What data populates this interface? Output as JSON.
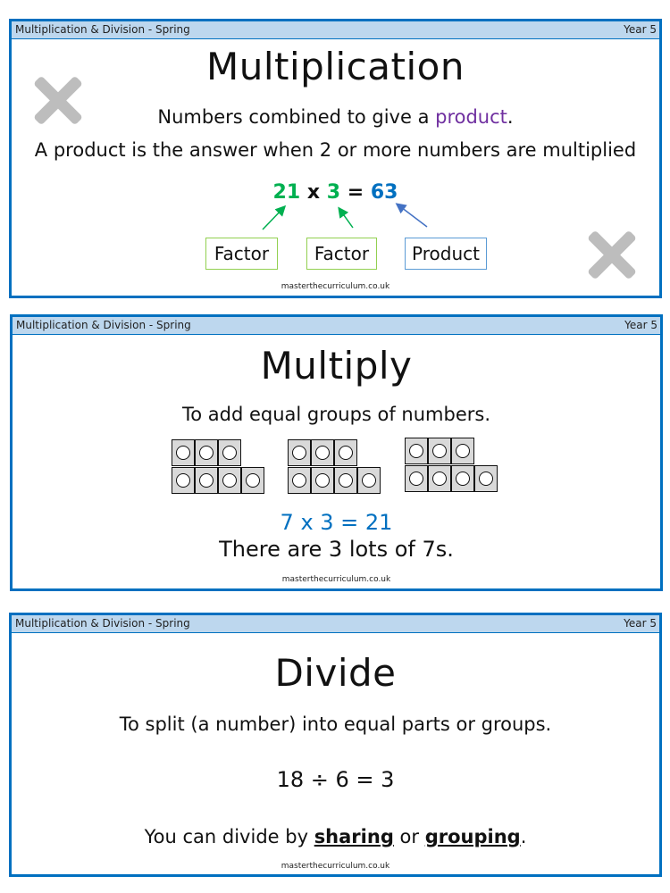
{
  "header": {
    "topic": "Multiplication & Division - Spring",
    "year": "Year 5"
  },
  "footer": "masterthecurriculum.co.uk",
  "cards": [
    {
      "title": "Multiplication",
      "line1_prefix": "Numbers combined to give a ",
      "line1_highlight": "product",
      "line1_suffix": ".",
      "line2": "A product is the answer when 2 or more numbers are multiplied",
      "equation": {
        "factor1": "21",
        "op": "x",
        "factor2": "3",
        "eq": "=",
        "product": "63"
      },
      "labels": [
        "Factor",
        "Factor",
        "Product"
      ],
      "icons": [
        "cross-icon",
        "cross-icon"
      ],
      "colors": {
        "highlight": "#7030a0",
        "factor": "#00b050",
        "product": "#0070c0"
      }
    },
    {
      "title": "Multiply",
      "definition": "To add equal groups of numbers.",
      "cube_groups": [
        {
          "top_row": 3,
          "bottom_row": 4
        },
        {
          "top_row": 3,
          "bottom_row": 4
        },
        {
          "top_row": 3,
          "bottom_row": 4
        }
      ],
      "equation": "7 x 3 = 21",
      "explanation": "There are 3 lots of 7s."
    },
    {
      "title": "Divide",
      "definition": "To split (a number) into equal parts or groups.",
      "equation": "18 ÷ 6 = 3",
      "method_prefix": "You can divide by ",
      "method_1": "sharing",
      "method_mid": " or ",
      "method_2": "grouping",
      "method_suffix": "."
    }
  ]
}
